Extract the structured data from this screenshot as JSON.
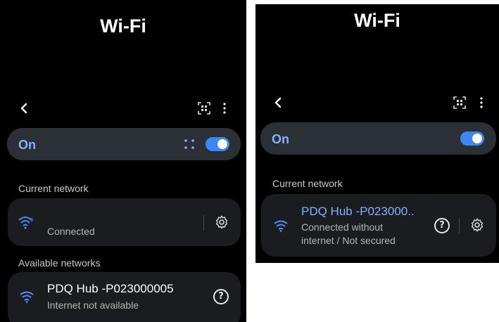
{
  "left": {
    "title": "Wi-Fi",
    "on_label": "On",
    "current_network_header": "Current network",
    "current_network": {
      "name": "",
      "status": "Connected"
    },
    "available_networks_header": "Available networks",
    "available_networks": [
      {
        "name": "PDQ Hub -P023000005",
        "status": "Internet not available",
        "help": "?"
      }
    ]
  },
  "right": {
    "title": "Wi-Fi",
    "on_label": "On",
    "current_network_header": "Current network",
    "current_network": {
      "name": "PDQ Hub -P023000..",
      "status_line1": "Connected without",
      "status_line2": "internet / Not secured",
      "help": "?"
    }
  },
  "colors": {
    "accent": "#3d86f5",
    "link_blue": "#7fb4ff",
    "card": "#1b1c1f",
    "bar": "#2b2f36"
  },
  "icons": [
    "back-arrow-icon",
    "qr-scan-icon",
    "more-vert-icon",
    "wifi-direct-icon",
    "wifi-icon",
    "gear-icon",
    "help-icon"
  ]
}
